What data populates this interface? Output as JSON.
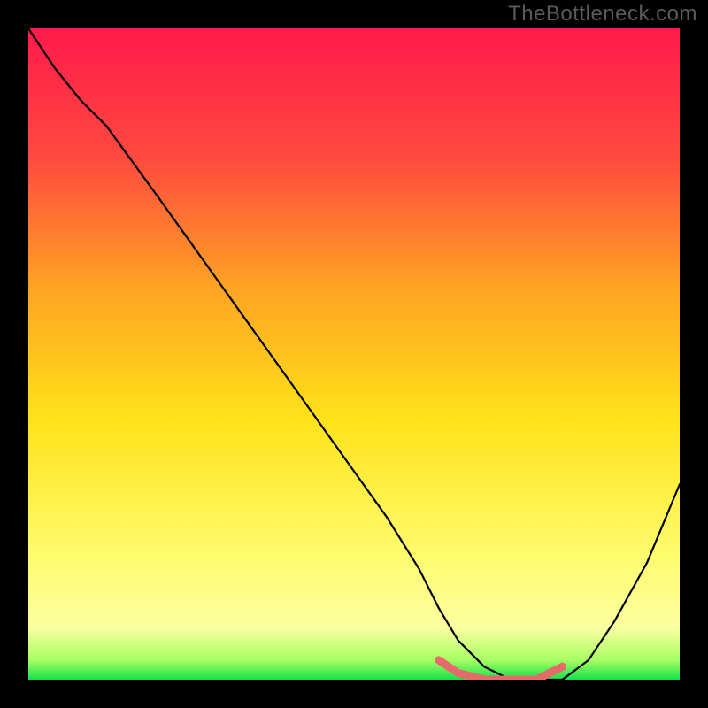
{
  "watermark": "TheBottleneck.com",
  "colors": {
    "frame_bg": "#000000",
    "gradient_stops": [
      {
        "offset": 0.0,
        "color": "#ff1a4b"
      },
      {
        "offset": 0.2,
        "color": "#ff4a3f"
      },
      {
        "offset": 0.4,
        "color": "#ffa423"
      },
      {
        "offset": 0.6,
        "color": "#ffe21a"
      },
      {
        "offset": 0.8,
        "color": "#fffb6a"
      },
      {
        "offset": 0.92,
        "color": "#fbffa0"
      },
      {
        "offset": 0.97,
        "color": "#a7ff63"
      },
      {
        "offset": 1.0,
        "color": "#15e04b"
      }
    ],
    "curve": "#000000",
    "highlight": "#e56a6a"
  },
  "chart_data": {
    "type": "line",
    "title": "",
    "xlabel": "",
    "ylabel": "",
    "xlim": [
      0,
      100
    ],
    "ylim": [
      0,
      100
    ],
    "series": [
      {
        "name": "bottleneck-curve",
        "x": [
          0,
          4,
          8,
          12,
          20,
          30,
          40,
          50,
          55,
          60,
          63,
          66,
          70,
          74,
          78,
          82,
          86,
          90,
          95,
          100
        ],
        "values": [
          100,
          94,
          89,
          85,
          74,
          60,
          46,
          32,
          25,
          17,
          11,
          6,
          2,
          0,
          0,
          0,
          3,
          9,
          18,
          30
        ]
      },
      {
        "name": "optimal-range-highlight",
        "x": [
          63,
          66,
          70,
          74,
          78,
          82
        ],
        "values": [
          3,
          1,
          0,
          0,
          0,
          2
        ]
      }
    ]
  }
}
